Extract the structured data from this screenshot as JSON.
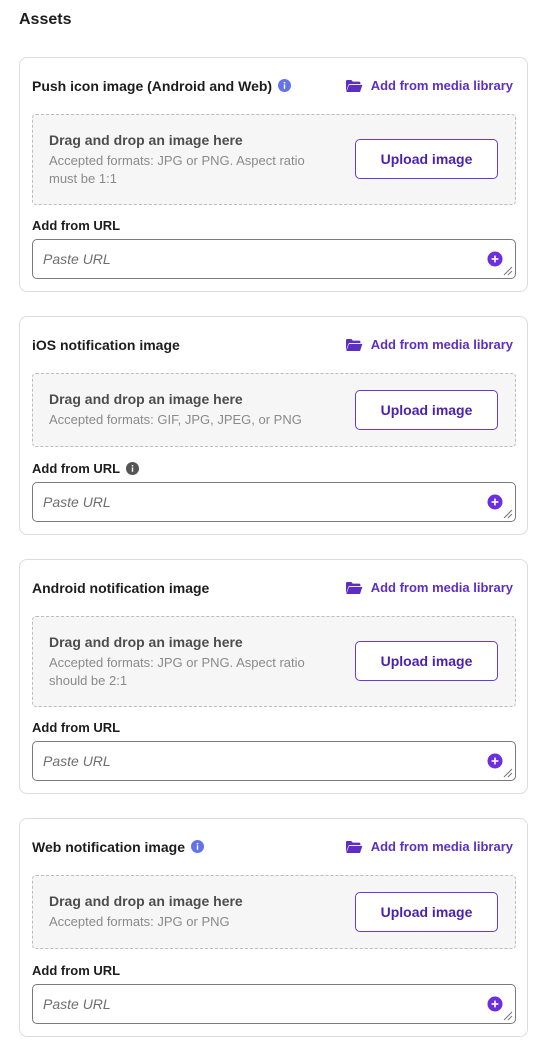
{
  "section_title": "Assets",
  "colors": {
    "accent": "#5c2fc2",
    "info_blue": "#6474e8",
    "info_dark": "#555555"
  },
  "cards": [
    {
      "title": "Push icon image (Android and Web)",
      "title_info_icon": "info-circle-blue",
      "media_link": "Add from media library",
      "dropzone_title": "Drag and drop an image here",
      "dropzone_desc": "Accepted formats: JPG or PNG. Aspect ratio must be 1:1",
      "upload_label": "Upload image",
      "url_label": "Add from URL",
      "url_placeholder": "Paste URL"
    },
    {
      "title": "iOS notification image",
      "media_link": "Add from media library",
      "dropzone_title": "Drag and drop an image here",
      "dropzone_desc": "Accepted formats: GIF, JPG, JPEG, or PNG",
      "upload_label": "Upload image",
      "url_label": "Add from URL",
      "url_label_info_icon": "info-circle-dark",
      "url_placeholder": "Paste URL"
    },
    {
      "title": "Android notification image",
      "media_link": "Add from media library",
      "dropzone_title": "Drag and drop an image here",
      "dropzone_desc": "Accepted formats: JPG or PNG. Aspect ratio should be 2:1",
      "upload_label": "Upload image",
      "url_label": "Add from URL",
      "url_placeholder": "Paste URL"
    },
    {
      "title": "Web notification image",
      "title_info_icon": "info-circle-blue",
      "media_link": "Add from media library",
      "dropzone_title": "Drag and drop an image here",
      "dropzone_desc": "Accepted formats: JPG or PNG",
      "upload_label": "Upload image",
      "url_label": "Add from URL",
      "url_placeholder": "Paste URL"
    }
  ]
}
